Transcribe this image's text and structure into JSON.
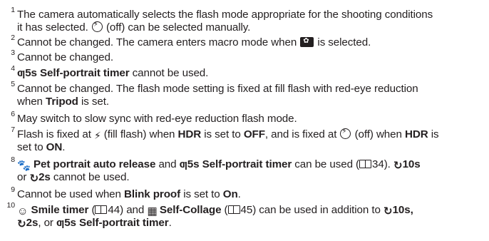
{
  "footnotes": [
    {
      "num": "1",
      "line1": "The camera automatically selects the flash mode appropriate for the shooting conditions",
      "line2a": "it has selected.",
      "line2b": "(off) can be selected manually."
    },
    {
      "num": "2",
      "a": "Cannot be changed. The camera enters macro mode when",
      "b": "is selected."
    },
    {
      "num": "3",
      "text": "Cannot be changed."
    },
    {
      "num": "4",
      "bold": "ƣ5s Self-portrait timer",
      "rest": "cannot be used."
    },
    {
      "num": "5",
      "line1": "Cannot be changed. The flash mode setting is fixed at fill flash with red-eye reduction",
      "line2a": "when",
      "line2bold": "Tripod",
      "line2b": "is set."
    },
    {
      "num": "6",
      "text": "May switch to slow sync with red-eye reduction flash mode."
    },
    {
      "num": "7",
      "a": "Flash is fixed at",
      "b": "(fill flash) when",
      "hdr1": "HDR",
      "c": "is set to",
      "off": "OFF",
      "d": ", and is fixed at",
      "e": "(off) when",
      "hdr2": "HDR",
      "f": "is",
      "line2a": "set to",
      "on": "ON",
      "line2b": "."
    },
    {
      "num": "8",
      "bold1": "Pet portrait auto release",
      "a": "and",
      "bold2": "ƣ5s Self-portrait timer",
      "b": "can be used (",
      "ref": "34).",
      "bold3": "10s",
      "line2a": "or",
      "bold4": "2s",
      "line2b": "cannot be used."
    },
    {
      "num": "9",
      "a": "Cannot be used when",
      "bold": "Blink proof",
      "b": "is set to",
      "on": "On",
      "c": "."
    },
    {
      "num": "10",
      "bold1": "Smile timer",
      "a": "(",
      "ref1": "44) and",
      "bold2": "Self-Collage",
      "b": "(",
      "ref2": "45) can be used in addition to",
      "bold3": "10s,",
      "line2bold1": "2s",
      "line2a": ", or",
      "line2bold2": "ƣ5s Self-portrait timer",
      "line2b": "."
    }
  ],
  "icons": {
    "flash_off": "flash-off-icon",
    "macro": "macro-flower-icon",
    "fill_flash": "lightning-bolt-icon",
    "timer": "self-timer-icon",
    "book": "page-reference-icon",
    "pet": "pet-portrait-icon",
    "smile": "smile-timer-icon",
    "collage": "self-collage-icon"
  }
}
